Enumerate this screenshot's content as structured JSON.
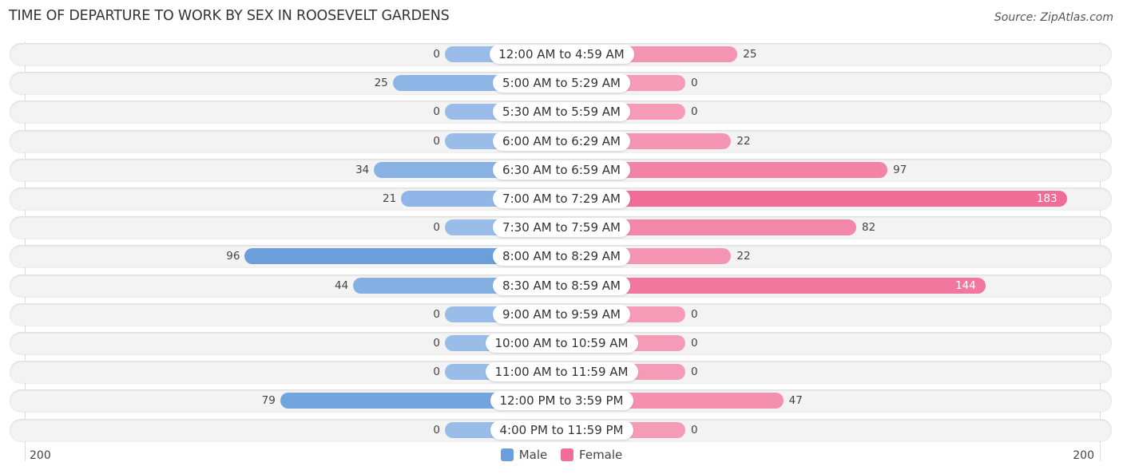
{
  "chart_data": {
    "type": "bar",
    "orientation": "horizontal-diverging",
    "title": "TIME OF DEPARTURE TO WORK BY SEX IN ROOSEVELT GARDENS",
    "source": "Source: ZipAtlas.com",
    "categories": [
      "12:00 AM to 4:59 AM",
      "5:00 AM to 5:29 AM",
      "5:30 AM to 5:59 AM",
      "6:00 AM to 6:29 AM",
      "6:30 AM to 6:59 AM",
      "7:00 AM to 7:29 AM",
      "7:30 AM to 7:59 AM",
      "8:00 AM to 8:29 AM",
      "8:30 AM to 8:59 AM",
      "9:00 AM to 9:59 AM",
      "10:00 AM to 10:59 AM",
      "11:00 AM to 11:59 AM",
      "12:00 PM to 3:59 PM",
      "4:00 PM to 11:59 PM"
    ],
    "series": [
      {
        "name": "Male",
        "color": "#6a9fdc",
        "values": [
          0,
          25,
          0,
          0,
          34,
          21,
          0,
          96,
          44,
          0,
          0,
          0,
          79,
          0
        ]
      },
      {
        "name": "Female",
        "color": "#f06d97",
        "values": [
          25,
          0,
          0,
          22,
          97,
          183,
          82,
          22,
          144,
          0,
          0,
          0,
          47,
          0
        ]
      }
    ],
    "axis": {
      "left_label": "200",
      "right_label": "200",
      "max": 200
    },
    "legend": [
      {
        "name": "Male",
        "color": "#6a9fdc"
      },
      {
        "name": "Female",
        "color": "#f06d97"
      }
    ],
    "legend_position": "bottom-center",
    "grid": false
  }
}
